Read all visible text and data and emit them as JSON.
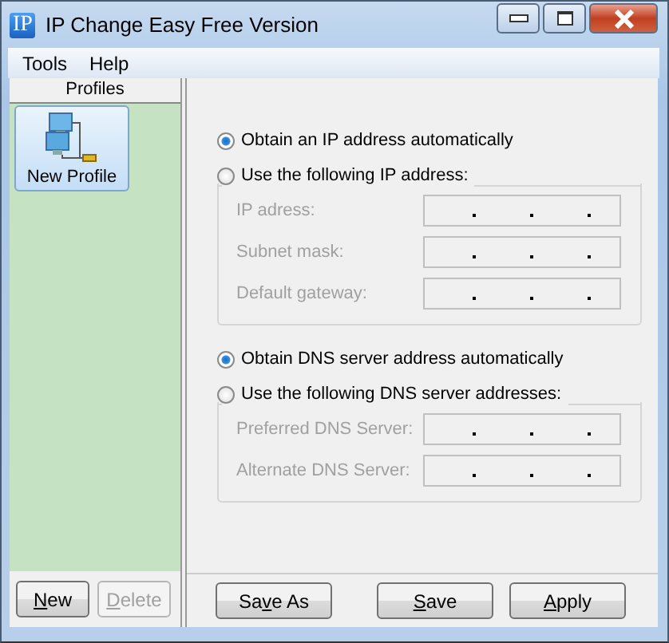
{
  "window": {
    "icon_text": "IP",
    "title": "IP Change Easy Free Version"
  },
  "menu": [
    "Tools",
    "Help"
  ],
  "profiles": {
    "header": "Profiles",
    "items": [
      {
        "label": "New Profile",
        "selected": true
      }
    ],
    "buttons": [
      {
        "key": "N",
        "post": "ew",
        "disabled": false
      },
      {
        "key": "D",
        "post": "elete",
        "disabled": true
      }
    ]
  },
  "ip_section": {
    "options": [
      {
        "label": "Obtain an IP address automatically",
        "selected": true
      },
      {
        "label": "Use the following IP address:",
        "selected": false
      }
    ],
    "fields": [
      {
        "label": "IP adress:",
        "disabled": true
      },
      {
        "label": "Subnet mask:",
        "disabled": true
      },
      {
        "label": "Default gateway:",
        "disabled": true
      }
    ]
  },
  "dns_section": {
    "options": [
      {
        "label": "Obtain DNS server address automatically",
        "selected": true
      },
      {
        "label": "Use the following DNS server addresses:",
        "selected": false
      }
    ],
    "fields": [
      {
        "label": "Preferred DNS Server:",
        "disabled": true
      },
      {
        "label": "Alternate DNS Server:",
        "disabled": true
      }
    ]
  },
  "buttons": [
    {
      "pre": "Sa",
      "key": "v",
      "post": "e As",
      "disabled": false
    },
    {
      "key": "S",
      "post": "ave",
      "disabled": false
    },
    {
      "key": "A",
      "post": "pply",
      "disabled": false
    }
  ]
}
